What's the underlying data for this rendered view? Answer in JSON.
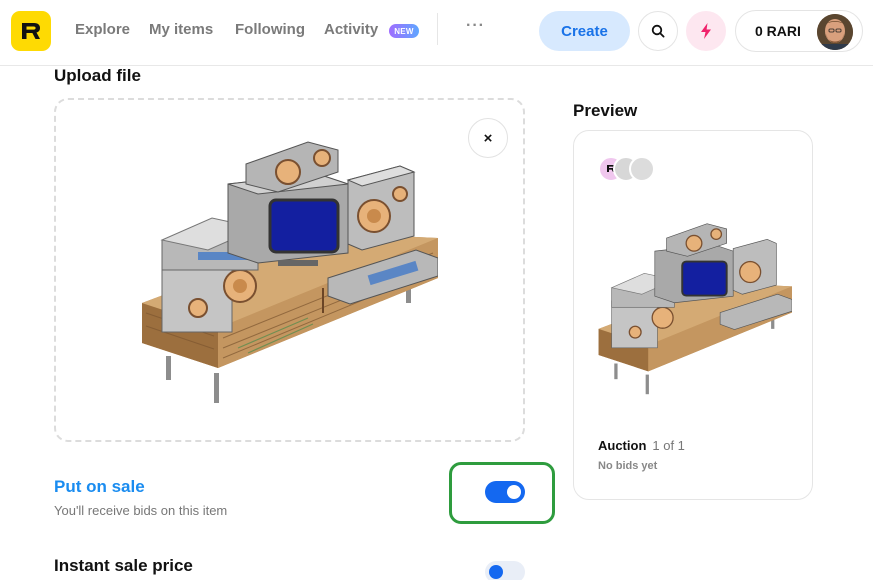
{
  "header": {
    "logo_letter": "R",
    "nav": [
      "Explore",
      "My items",
      "Following",
      "Activity"
    ],
    "new_badge": "NEW",
    "more": "···",
    "create_label": "Create",
    "balance": "0 RARI"
  },
  "upload": {
    "title": "Upload file",
    "close_symbol": "×"
  },
  "preview": {
    "title": "Preview",
    "auction_label": "Auction",
    "auction_count": "1 of 1",
    "bids_text": "No bids yet"
  },
  "sale": {
    "title": "Put on sale",
    "subtitle": "You'll receive bids on this item",
    "enabled": true
  },
  "instant": {
    "title": "Instant sale price"
  },
  "colors": {
    "accent": "#1468f0",
    "logo_bg": "#feda03",
    "highlight": "#2e9c3e"
  }
}
